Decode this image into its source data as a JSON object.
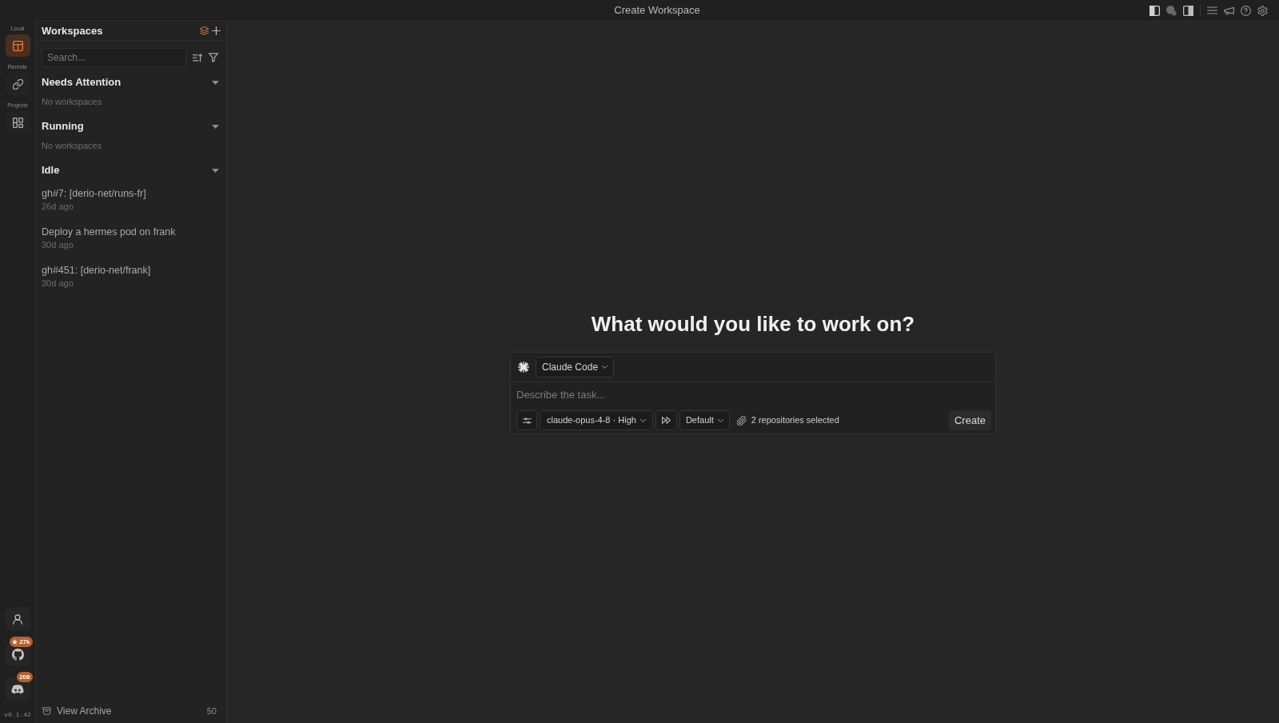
{
  "window": {
    "title": "Create Workspace"
  },
  "rail": {
    "sections": [
      {
        "label": "Local",
        "selected": true
      },
      {
        "label": "Remote",
        "selected": false
      },
      {
        "label": "Projects",
        "selected": false
      }
    ],
    "links": [
      {
        "kind": "account"
      },
      {
        "kind": "github",
        "badge": "27k"
      },
      {
        "kind": "discord",
        "badge": "208"
      }
    ],
    "version": "v0.1.42"
  },
  "sidebar": {
    "title": "Workspaces",
    "search": {
      "placeholder": "Search..."
    },
    "groups": [
      {
        "title": "Needs Attention",
        "expanded": true,
        "empty_text": "No workspaces"
      },
      {
        "title": "Running",
        "expanded": true,
        "empty_text": "No workspaces"
      },
      {
        "title": "Idle",
        "expanded": true,
        "items": [
          {
            "title": "gh#7: [derio-net/runs-fr]",
            "time": "26d ago",
            "selected": false
          },
          {
            "title": "Deploy a hermes pod on frank",
            "time": "30d ago",
            "selected": false
          },
          {
            "title": "gh#451: [derio-net/frank]",
            "time": "30d ago",
            "selected": false
          }
        ]
      }
    ],
    "archive": {
      "label": "View Archive",
      "count": "50"
    }
  },
  "main": {
    "heading": "What would you like to work on?",
    "composer": {
      "agent": "Claude Code",
      "placeholder": "Describe the task...",
      "model": "claude-opus-4-8 · High",
      "mode": "Default",
      "repositories": "2 repositories selected",
      "submit": "Create"
    }
  }
}
